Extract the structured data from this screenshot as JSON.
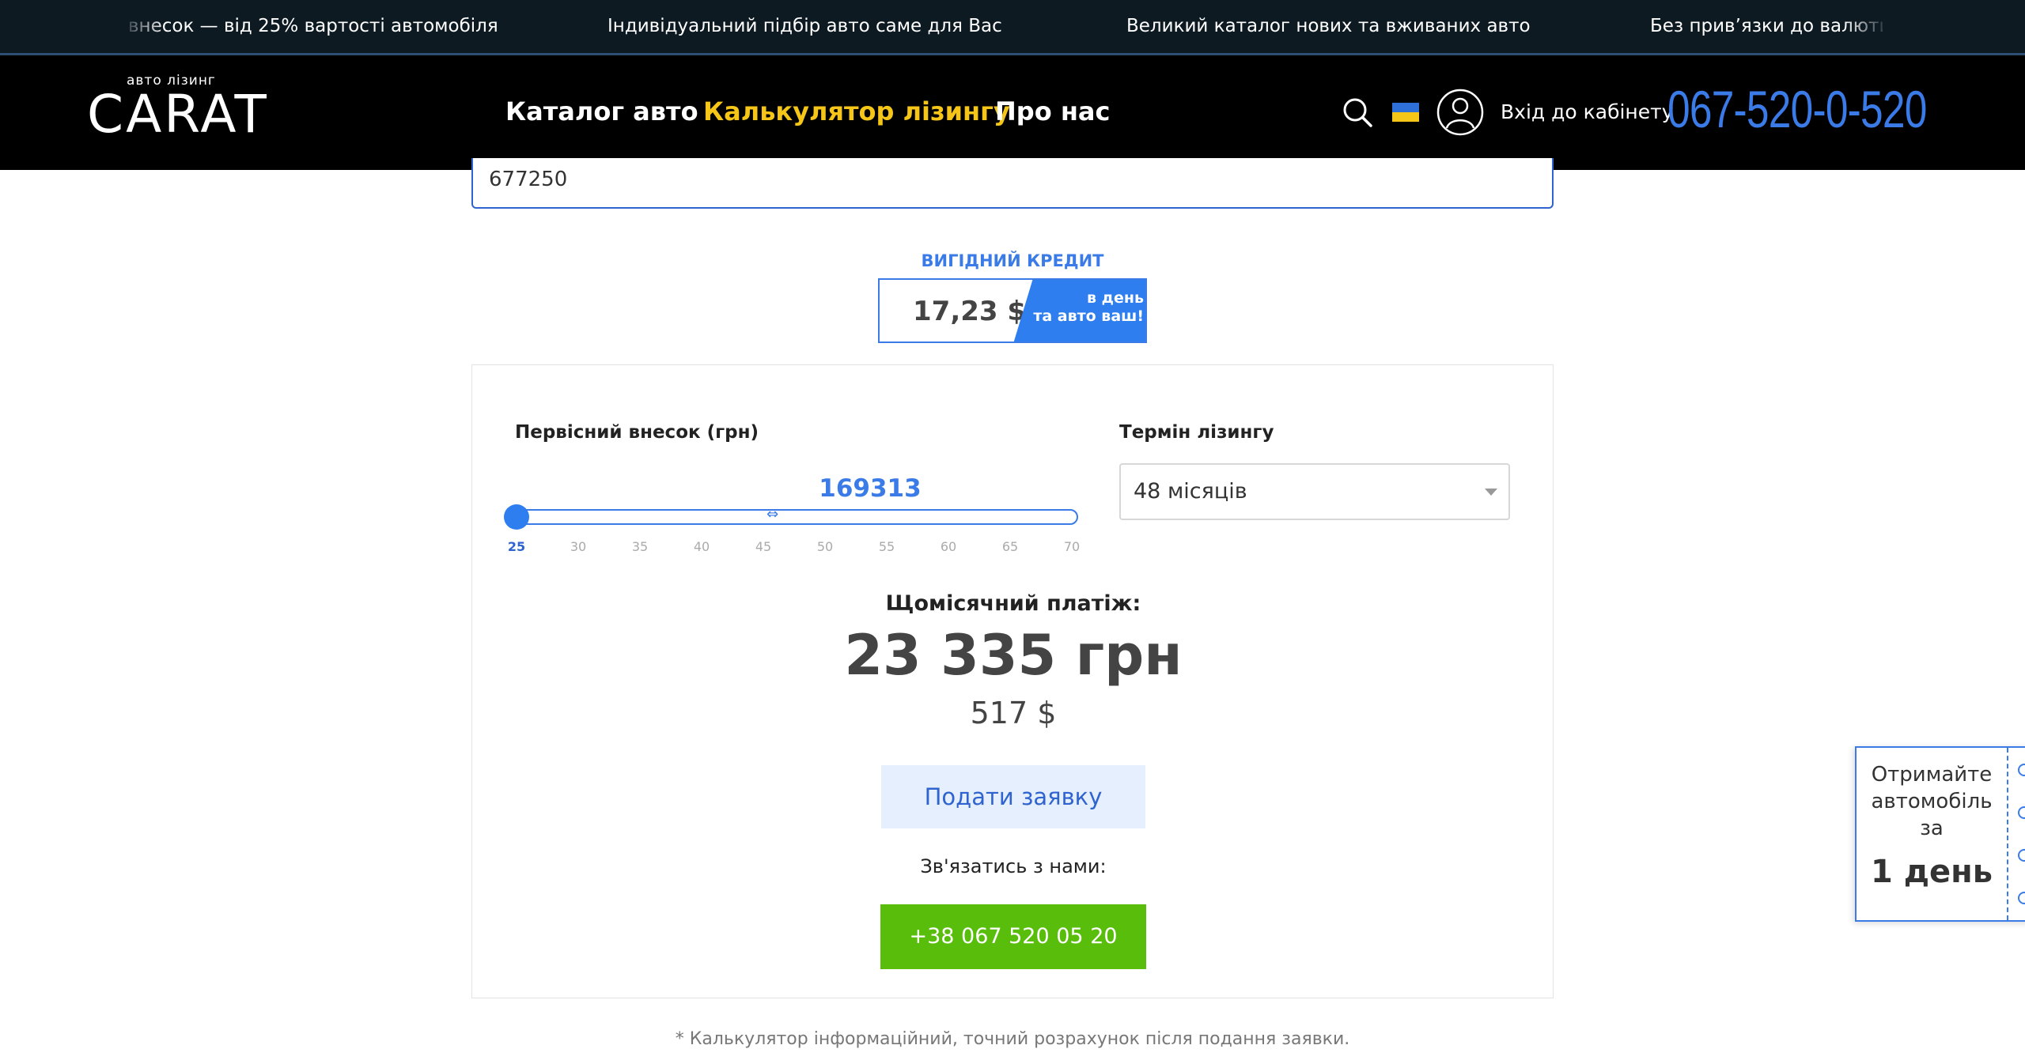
{
  "marquee": {
    "items": [
      "внесок — від 25% вартості автомобіля",
      "Індивідуальний підбір авто саме для Вас",
      "Великий каталог нових та вживаних авто",
      "Без прив’язки до валюти"
    ]
  },
  "header": {
    "logo_sub": "авто лізинг",
    "logo_main": "CARAT",
    "nav": [
      "Каталог авто",
      "Калькулятор лізингу",
      "Про нас"
    ],
    "active_nav": "Калькулятор лізингу",
    "login_label": "Вхід до кабінету",
    "phone": "067-520-0-520",
    "icons": [
      "search-icon",
      "ukraine-flag-icon",
      "user-icon"
    ]
  },
  "price_input": {
    "value": "677250"
  },
  "credit": {
    "label": "ВИГІДНИЙ КРЕДИТ",
    "value": "17,23 $",
    "side_line1": "в день",
    "side_line2": "та авто ваш!"
  },
  "calculator": {
    "down_payment_label": "Первісний внесок (грн)",
    "down_payment_value": "169313",
    "down_payment_percent": 25,
    "slider_ticks": [
      "25",
      "30",
      "35",
      "40",
      "45",
      "50",
      "55",
      "60",
      "65",
      "70"
    ],
    "term_label": "Термін лізингу",
    "term_value": "48 місяців",
    "monthly_label": "Щомісячний платіж:",
    "monthly_uah": "23 335 грн",
    "monthly_usd": "517 $",
    "apply_label": "Подати заявку",
    "contact_label": "Зв'язатись з нами:",
    "contact_phone": "+38 067 520 05 20"
  },
  "footnote": {
    "line1": "* Калькулятор інформаційний, точний розрахунок після подання заявки."
  },
  "promo": {
    "text": "Отримайте автомобіль за",
    "day": "1 день"
  },
  "colors": {
    "accent": "#3a7be8",
    "nav_active": "#f5c518",
    "contact_button": "#58be0b",
    "header_bg": "#000000"
  }
}
